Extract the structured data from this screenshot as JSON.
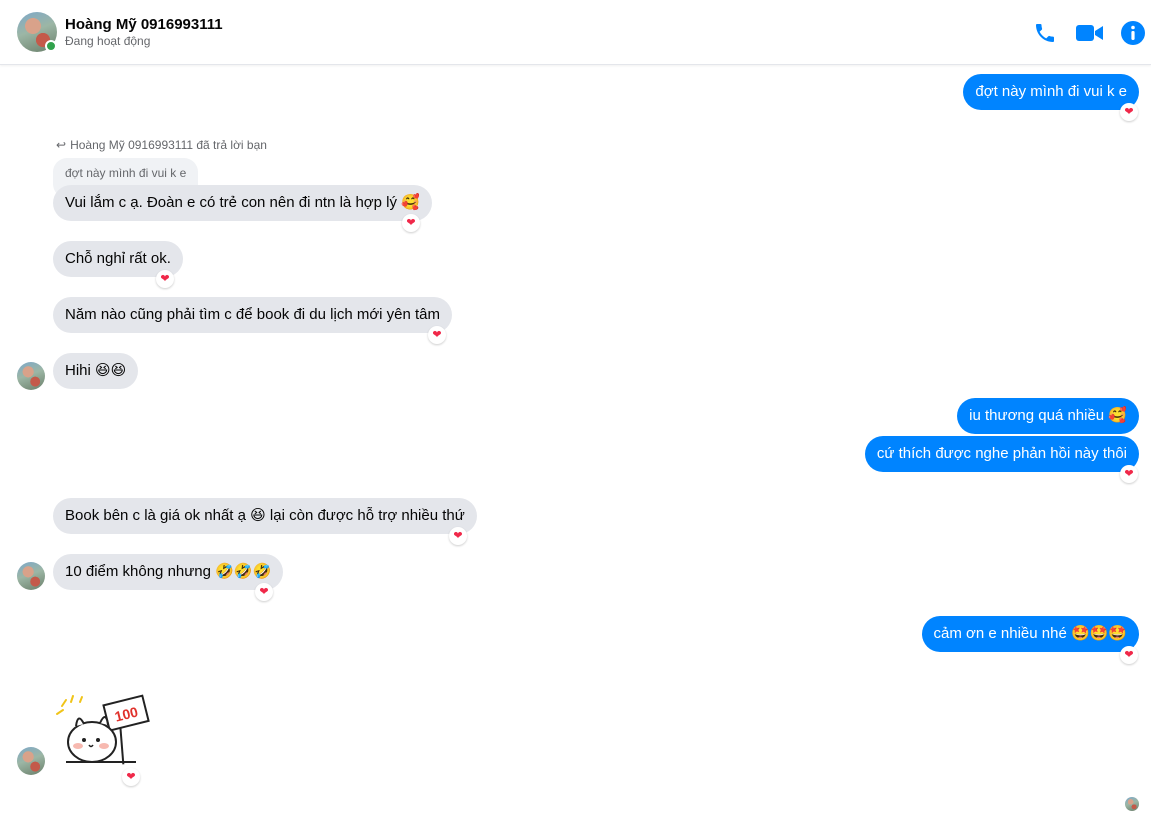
{
  "header": {
    "name": "Hoàng Mỹ 0916993111",
    "status": "Đang hoạt động",
    "icons": [
      "phone-icon",
      "video-camera-icon",
      "info-icon"
    ],
    "accent": "#0084ff"
  },
  "reply": {
    "label": "Hoàng Mỹ 0916993111 đã trả lời bạn",
    "quoted": "đợt này mình đi vui k e"
  },
  "messages": [
    {
      "from": "me",
      "text": "đợt này mình đi vui k e"
    },
    {
      "from": "them",
      "text": "Vui lắm c ạ. Đoàn e có trẻ con nên đi ntn là hợp lý 🥰"
    },
    {
      "from": "them",
      "text": "Chỗ nghỉ rất ok."
    },
    {
      "from": "them",
      "text": "Năm nào cũng phải tìm c để book đi du lịch mới yên tâm"
    },
    {
      "from": "them",
      "text": "Hihi 😆😆"
    },
    {
      "from": "me",
      "text": "iu thương quá nhiều 🥰"
    },
    {
      "from": "me",
      "text": "cứ thích được nghe phản hồi này thôi"
    },
    {
      "from": "them",
      "text": "Book bên c là giá ok nhất ạ 😆 lại còn được hỗ trợ nhiều thứ"
    },
    {
      "from": "them",
      "text": "10 điểm không nhưng 🤣🤣🤣"
    },
    {
      "from": "me",
      "text": "cảm ơn e nhiều nhé 🤩🤩🤩"
    }
  ],
  "sticker": {
    "text": "100"
  },
  "reaction": "❤"
}
